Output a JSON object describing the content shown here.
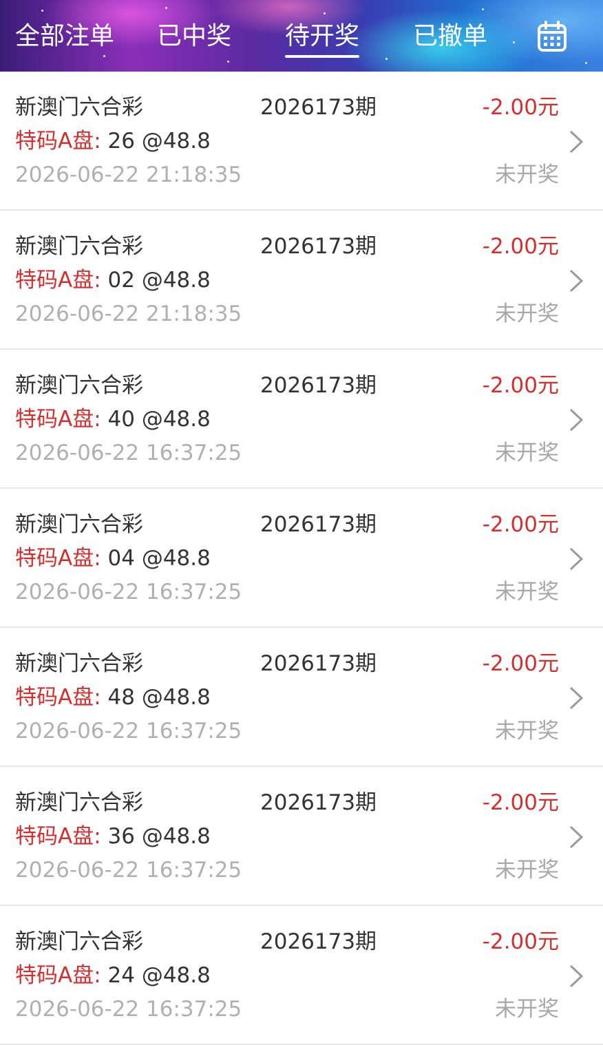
{
  "tabs": [
    {
      "label": "全部注单",
      "active": false
    },
    {
      "label": "已中奖",
      "active": false
    },
    {
      "label": "待开奖",
      "active": true
    },
    {
      "label": "已撤单",
      "active": false
    }
  ],
  "calendar_icon": "calendar-icon",
  "colors": {
    "accent_red": "#d32f2f",
    "text_dark": "#333333",
    "text_muted": "#b0b0b0",
    "divider": "#e8e8e8"
  },
  "orders": [
    {
      "lottery": "新澳门六合彩",
      "period": "2026173期",
      "amount": "-2.00元",
      "bet_label": "特码A盘:",
      "bet_value": "26 @48.8",
      "time": "2026-06-22 21:18:35",
      "status": "未开奖"
    },
    {
      "lottery": "新澳门六合彩",
      "period": "2026173期",
      "amount": "-2.00元",
      "bet_label": "特码A盘:",
      "bet_value": "02 @48.8",
      "time": "2026-06-22 21:18:35",
      "status": "未开奖"
    },
    {
      "lottery": "新澳门六合彩",
      "period": "2026173期",
      "amount": "-2.00元",
      "bet_label": "特码A盘:",
      "bet_value": "40 @48.8",
      "time": "2026-06-22 16:37:25",
      "status": "未开奖"
    },
    {
      "lottery": "新澳门六合彩",
      "period": "2026173期",
      "amount": "-2.00元",
      "bet_label": "特码A盘:",
      "bet_value": "04 @48.8",
      "time": "2026-06-22 16:37:25",
      "status": "未开奖"
    },
    {
      "lottery": "新澳门六合彩",
      "period": "2026173期",
      "amount": "-2.00元",
      "bet_label": "特码A盘:",
      "bet_value": "48 @48.8",
      "time": "2026-06-22 16:37:25",
      "status": "未开奖"
    },
    {
      "lottery": "新澳门六合彩",
      "period": "2026173期",
      "amount": "-2.00元",
      "bet_label": "特码A盘:",
      "bet_value": "36 @48.8",
      "time": "2026-06-22 16:37:25",
      "status": "未开奖"
    },
    {
      "lottery": "新澳门六合彩",
      "period": "2026173期",
      "amount": "-2.00元",
      "bet_label": "特码A盘:",
      "bet_value": "24 @48.8",
      "time": "2026-06-22 16:37:25",
      "status": "未开奖"
    }
  ]
}
